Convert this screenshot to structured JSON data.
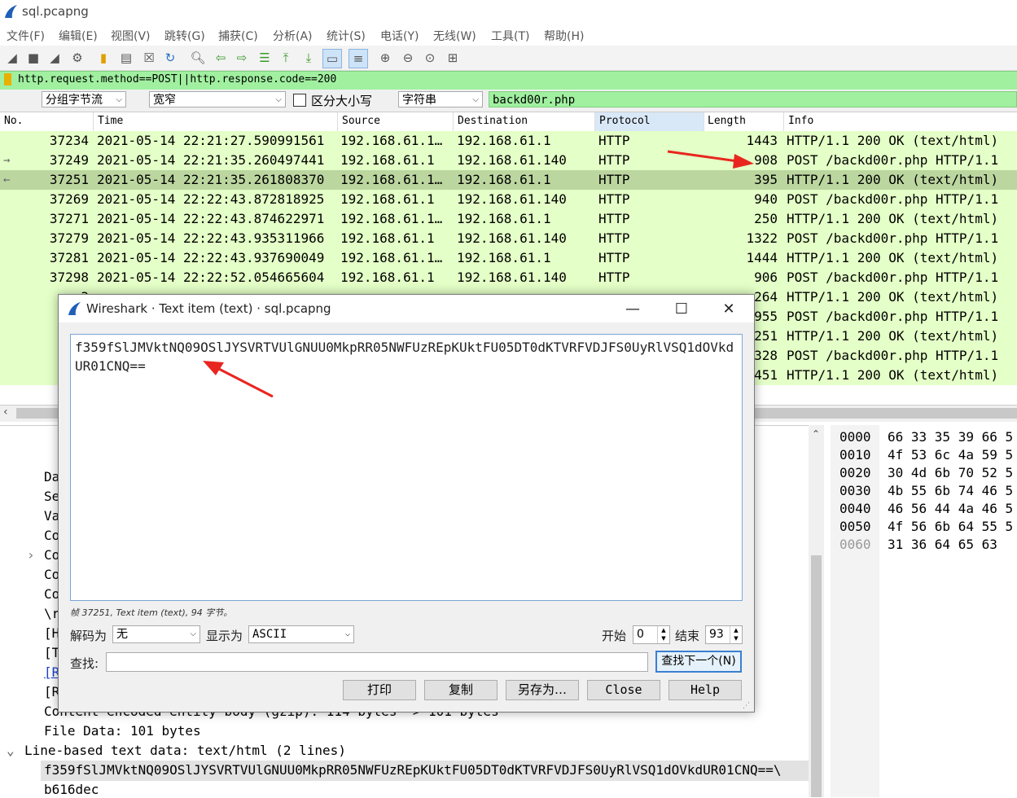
{
  "window": {
    "title": "sql.pcapng"
  },
  "menu": [
    "文件(F)",
    "编辑(E)",
    "视图(V)",
    "跳转(G)",
    "捕获(C)",
    "分析(A)",
    "统计(S)",
    "电话(Y)",
    "无线(W)",
    "工具(T)",
    "帮助(H)"
  ],
  "filter": {
    "value": "http.request.method==POST||http.response.code==200"
  },
  "search": {
    "mode": "分组字节流",
    "width": "宽窄",
    "case_label": "区分大小写",
    "type": "字符串",
    "value": "backd00r.php"
  },
  "columns": [
    "No.",
    "Time",
    "Source",
    "Destination",
    "Protocol",
    "Length",
    "Info"
  ],
  "packets": [
    {
      "no": "37234",
      "time": "2021-05-14 22:21:27.590991561",
      "src": "192.168.61.1…",
      "dst": "192.168.61.1",
      "proto": "HTTP",
      "len": "1443",
      "info": "HTTP/1.1 200 OK  (text/html)"
    },
    {
      "no": "37249",
      "time": "2021-05-14 22:21:35.260497441",
      "src": "192.168.61.1",
      "dst": "192.168.61.140",
      "proto": "HTTP",
      "len": "908",
      "info": "POST /backd00r.php HTTP/1.1"
    },
    {
      "no": "37251",
      "time": "2021-05-14 22:21:35.261808370",
      "src": "192.168.61.1…",
      "dst": "192.168.61.1",
      "proto": "HTTP",
      "len": "395",
      "info": "HTTP/1.1 200 OK  (text/html)"
    },
    {
      "no": "37269",
      "time": "2021-05-14 22:22:43.872818925",
      "src": "192.168.61.1",
      "dst": "192.168.61.140",
      "proto": "HTTP",
      "len": "940",
      "info": "POST /backd00r.php HTTP/1.1"
    },
    {
      "no": "37271",
      "time": "2021-05-14 22:22:43.874622971",
      "src": "192.168.61.1…",
      "dst": "192.168.61.1",
      "proto": "HTTP",
      "len": "250",
      "info": "HTTP/1.1 200 OK  (text/html)"
    },
    {
      "no": "37279",
      "time": "2021-05-14 22:22:43.935311966",
      "src": "192.168.61.1",
      "dst": "192.168.61.140",
      "proto": "HTTP",
      "len": "1322",
      "info": "POST /backd00r.php HTTP/1.1"
    },
    {
      "no": "37281",
      "time": "2021-05-14 22:22:43.937690049",
      "src": "192.168.61.1…",
      "dst": "192.168.61.1",
      "proto": "HTTP",
      "len": "1444",
      "info": "HTTP/1.1 200 OK  (text/html)"
    },
    {
      "no": "37298",
      "time": "2021-05-14 22:22:52.054665604",
      "src": "192.168.61.1",
      "dst": "192.168.61.140",
      "proto": "HTTP",
      "len": "906",
      "info": "POST /backd00r.php HTTP/1.1"
    },
    {
      "no": "3",
      "time": "",
      "src": "",
      "dst": "",
      "proto": "",
      "len": "264",
      "info": "HTTP/1.1 200 OK  (text/html)"
    },
    {
      "no": "3",
      "time": "",
      "src": "",
      "dst": "",
      "proto": "",
      "len": "955",
      "info": "POST /backd00r.php HTTP/1.1"
    },
    {
      "no": "3",
      "time": "",
      "src": "",
      "dst": "",
      "proto": "",
      "len": "251",
      "info": "HTTP/1.1 200 OK  (text/html)"
    },
    {
      "no": "3",
      "time": "",
      "src": "",
      "dst": "",
      "proto": "",
      "len": "1328",
      "info": "POST /backd00r.php HTTP/1.1"
    },
    {
      "no": "3",
      "time": "",
      "src": "",
      "dst": "",
      "proto": "",
      "len": "1451",
      "info": "HTTP/1.1 200 OK  (text/html)"
    }
  ],
  "detail": {
    "lines": [
      "Da",
      "Se",
      "Va",
      "Co",
      "Co",
      "Co",
      "Co",
      "\\r",
      "[H",
      "[T",
      "[R",
      "[R"
    ],
    "encoded": "Content-encoded entity body (gzip): 114 bytes -> 101 bytes",
    "file_data": "File Data: 101 bytes",
    "line_based": "Line-based text data: text/html (2 lines)",
    "payload": "f359fSlJMVktNQ09OSlJYSVRTVUlGNUU0MkpRR05NWFUzREpKUktFU05DT0dKTVRFVDJFS0UyRlVSQ1dOVkdUR01CNQ==\\",
    "payload2": "b616dec"
  },
  "hex": {
    "offsets": [
      "0000",
      "0010",
      "0020",
      "0030",
      "0040",
      "0050",
      "0060"
    ],
    "bytes": [
      "66 33 35 39 66 5",
      "4f 53 6c 4a 59 5",
      "30 4d 6b 70 52 5",
      "4b 55 6b 74 46 5",
      "46 56 44 4a 46 5",
      "4f 56 6b 64 55 5",
      "31 36 64 65 63"
    ]
  },
  "dialog": {
    "title": "Wireshark · Text item (text) · sql.pcapng",
    "content": "f359fSlJMVktNQ09OSlJYSVRTVUlGNUU0MkpRR05NWFUzREpKUktFU05DT0dKTVRFVDJFS0UyRlVSQ1dOVkdUR01CNQ==",
    "status": "帧 37251, Text item (text), 94 字节。",
    "decode_label": "解码为",
    "decode_value": "无",
    "show_label": "显示为",
    "show_value": "ASCII",
    "start_label": "开始",
    "start_value": "0",
    "end_label": "结束",
    "end_value": "93",
    "find_label": "查找:",
    "find_next": "查找下一个(N)",
    "print": "打印",
    "copy": "复制",
    "save_as": "另存为…",
    "close": "Close",
    "help": "Help"
  },
  "colors": {
    "row_bg": "#e4ffc7",
    "selected_row": "#bcd6a0",
    "filter_bg": "#a0f0a0",
    "arrow": "#e8261f"
  }
}
